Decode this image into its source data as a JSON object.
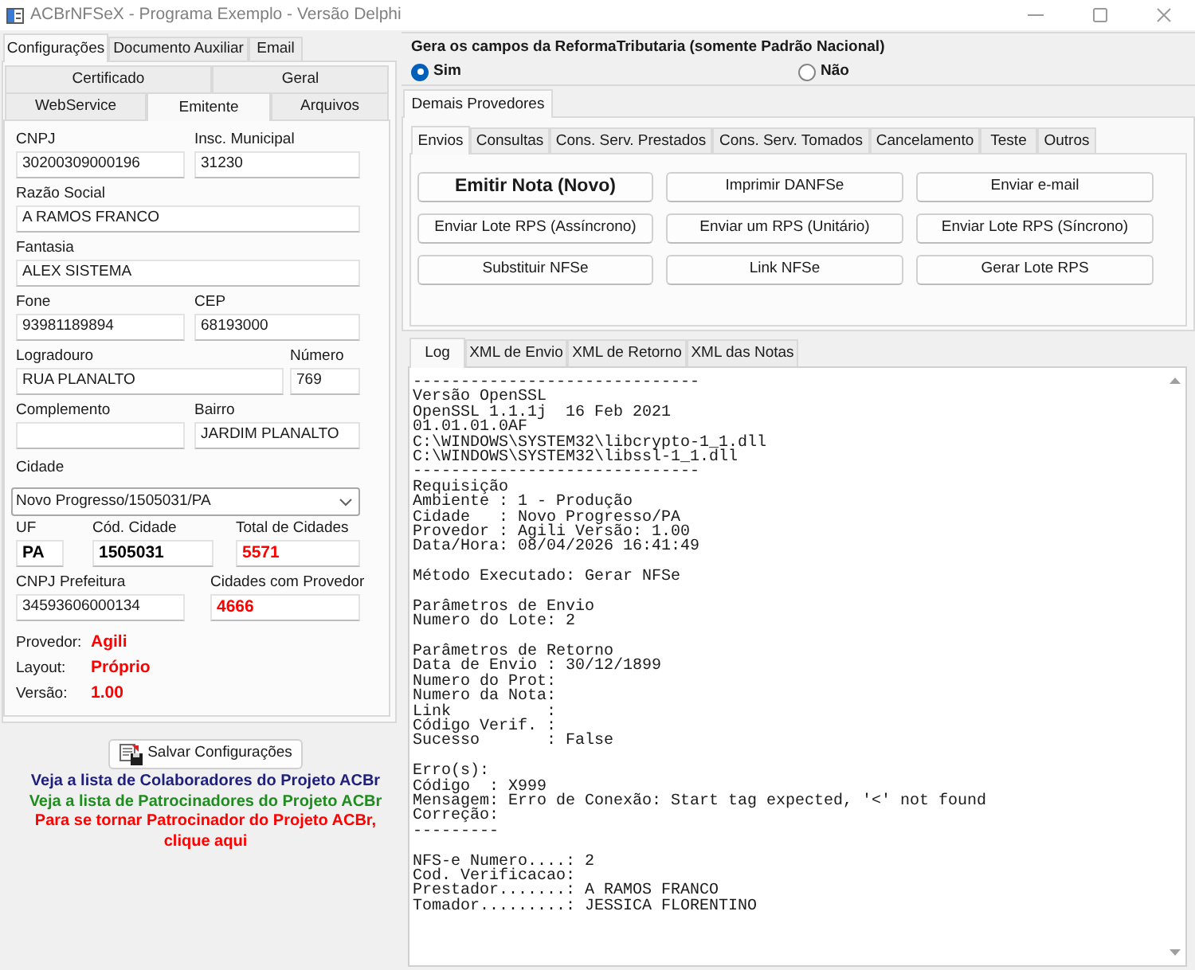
{
  "window": {
    "title": "ACBrNFSeX - Programa Exemplo - Versão Delphi"
  },
  "settings": {
    "tabs": [
      {
        "label": "Configurações",
        "selected": true
      },
      {
        "label": "Documento Auxiliar",
        "selected": false
      },
      {
        "label": "Email",
        "selected": false
      }
    ],
    "sub_tab_rows": [
      {
        "tabs": [
          {
            "label": "Certificado",
            "selected": false
          },
          {
            "label": "Geral",
            "selected": false
          }
        ]
      },
      {
        "tabs": [
          {
            "label": "WebService",
            "selected": false
          },
          {
            "label": "Emitente",
            "selected": true
          },
          {
            "label": "Arquivos",
            "selected": false
          }
        ]
      }
    ],
    "form_rows": [
      {
        "fields": [
          {
            "label": "CNPJ",
            "value": "30200309000196",
            "kind": "text"
          },
          {
            "label": "Insc. Municipal",
            "value": "31230",
            "kind": "text"
          }
        ]
      },
      {
        "fields": [
          {
            "label": "Razão Social",
            "value": "A RAMOS FRANCO",
            "kind": "text"
          }
        ]
      },
      {
        "fields": [
          {
            "label": "Fantasia",
            "value": "ALEX SISTEMA",
            "kind": "text"
          }
        ]
      },
      {
        "fields": [
          {
            "label": "Fone",
            "value": "93981189894",
            "kind": "text"
          },
          {
            "label": "CEP",
            "value": "68193000",
            "kind": "text"
          }
        ]
      },
      {
        "fields": [
          {
            "label": "Logradouro",
            "value": "RUA PLANALTO",
            "kind": "text"
          },
          {
            "label": "Número",
            "value": "769",
            "kind": "text"
          }
        ]
      },
      {
        "fields": [
          {
            "label": "Complemento",
            "kind": "text"
          },
          {
            "label": "Bairro",
            "value": "JARDIM PLANALTO",
            "kind": "text"
          }
        ]
      },
      {
        "fields": [
          {
            "label": "Cidade",
            "value": "Novo Progresso/1505031/PA",
            "kind": "select"
          }
        ]
      },
      {
        "fields": [
          {
            "label": "UF",
            "value": "PA",
            "kind": "code"
          },
          {
            "label": "Cód. Cidade",
            "value": "1505031",
            "kind": "code"
          },
          {
            "label": "Total de Cidades",
            "value": "5571",
            "kind": "count"
          }
        ]
      },
      {
        "fields": [
          {
            "label": "CNPJ Prefeitura",
            "value": "34593606000134",
            "kind": "text"
          },
          {
            "label": "Cidades com Provedor",
            "value": "4666",
            "kind": "count"
          }
        ]
      }
    ],
    "info": [
      {
        "label": "Provedor:",
        "value": "Agili"
      },
      {
        "label": "Layout:",
        "value": "Próprio"
      },
      {
        "label": "Versão:",
        "value": "1.00"
      }
    ],
    "save_button": "Salvar Configurações",
    "links": [
      {
        "text": "Veja a lista de Colaboradores do Projeto ACBr",
        "color": "#1f1f7a"
      },
      {
        "text": "Veja a lista de Patrocinadores do Projeto ACBr",
        "color": "#1e8c1e"
      },
      {
        "text": "Para se tornar Patrocinador do Projeto ACBr,\nclique aqui",
        "color": "#ff0000"
      }
    ]
  },
  "reforma": {
    "title": "Gera os campos da ReformaTributaria (somente Padrão Nacional)",
    "options": [
      {
        "label": "Sim",
        "selected": true
      },
      {
        "label": "Não",
        "selected": false
      }
    ]
  },
  "provider_tabs": [
    {
      "label": "Demais Provedores",
      "selected": true
    }
  ],
  "operation_tabs": [
    {
      "label": "Envios",
      "selected": true
    },
    {
      "label": "Consultas",
      "selected": false
    },
    {
      "label": "Cons. Serv. Prestados",
      "selected": false
    },
    {
      "label": "Cons. Serv. Tomados",
      "selected": false
    },
    {
      "label": "Cancelamento",
      "selected": false
    },
    {
      "label": "Teste",
      "selected": false
    },
    {
      "label": "Outros",
      "selected": false
    }
  ],
  "actions": [
    {
      "label": "Emitir Nota (Novo)",
      "kind": "primary"
    },
    {
      "label": "Imprimir DANFSe",
      "kind": "normal"
    },
    {
      "label": "Enviar e-mail",
      "kind": "normal"
    },
    {
      "label": "Enviar Lote RPS (Assíncrono)",
      "kind": "normal"
    },
    {
      "label": "Enviar um RPS (Unitário)",
      "kind": "normal"
    },
    {
      "label": "Enviar Lote RPS (Síncrono)",
      "kind": "normal"
    },
    {
      "label": "Substituir NFSe",
      "kind": "normal"
    },
    {
      "label": "Link NFSe",
      "kind": "normal"
    },
    {
      "label": "Gerar Lote RPS",
      "kind": "normal"
    }
  ],
  "output_tabs": [
    {
      "label": "Log",
      "selected": true
    },
    {
      "label": "XML de Envio",
      "selected": false
    },
    {
      "label": "XML de Retorno",
      "selected": false
    },
    {
      "label": "XML das Notas",
      "selected": false
    }
  ],
  "log": {
    "blocks": [
      {
        "lines": [
          "------------------------------",
          "Versão OpenSSL",
          "OpenSSL 1.1.1j  16 Feb 2021",
          "01.01.01.0AF",
          "C:\\WINDOWS\\SYSTEM32\\libcrypto-1_1.dll",
          "C:\\WINDOWS\\SYSTEM32\\libssl-1_1.dll",
          "------------------------------",
          "Requisição",
          "Ambiente : 1 - Produção",
          "Cidade   : Novo Progresso/PA",
          "Provedor : Agili Versão: 1.00",
          "Data/Hora: 08/04/2026 16:41:49"
        ]
      },
      {
        "lines": [
          "Método Executado: Gerar NFSe"
        ]
      },
      {
        "lines": [
          "Parâmetros de Envio",
          "Numero do Lote: 2"
        ]
      },
      {
        "lines": [
          "Parâmetros de Retorno",
          "Data de Envio : 30/12/1899",
          "Numero do Prot:",
          "Numero da Nota:",
          "Link          :",
          "Código Verif. :",
          "Sucesso       : False"
        ]
      },
      {
        "lines": [
          "Erro(s):",
          "Código  : X999",
          "Mensagem: Erro de Conexão: Start tag expected, '<' not found",
          "Correção:",
          "---------"
        ]
      },
      {
        "lines": [
          "NFS-e Numero....: 2",
          "Cod. Verificacao:",
          "Prestador.......: A RAMOS FRANCO",
          "Tomador.........: JESSICA FLORENTINO"
        ]
      }
    ]
  }
}
